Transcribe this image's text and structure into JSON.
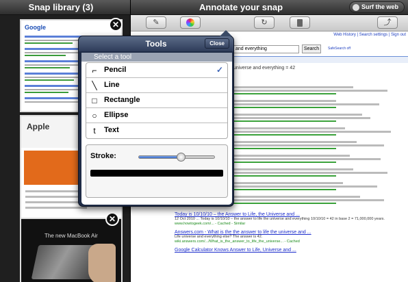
{
  "left_pane": {
    "title": "Snap library (3)",
    "thumbnails": [
      {
        "name": "google-search",
        "logo": "Google"
      },
      {
        "name": "apple-page",
        "logo": "Apple"
      },
      {
        "name": "macbook-air-video",
        "caption": "The new MacBook Air"
      }
    ]
  },
  "right_pane": {
    "title": "Annotate your snap",
    "surf_button": "Surf the web",
    "toolbar_icons": [
      "pencil-icon",
      "color-wheel-icon",
      "undo-icon",
      "trash-icon",
      "share-icon"
    ],
    "page": {
      "top_links": "Web History | Search settings | Sign out",
      "search_value": "and everything",
      "search_button": "Search",
      "advanced_link": "SafeSearch off",
      "result_line": "universe and everything = 42",
      "results": [
        {
          "title": "Today is 10/10/10 – the Answer to Life, the Universe and ...",
          "snippet": "12 Oct 2010 ... Today is 10/10/10 – the answer to life the universe and everything 10/10/10 = 42 in base 2 = 71,000,000 years.",
          "url": "www.howtogeek.com/... - Cached - Similar"
        },
        {
          "title": "Answers.com - What is the the answer to life the universe and ...",
          "snippet": "Life universe and everything else? The answer is 42.",
          "url": "wiki.answers.com/.../What_is_the_answer_to_life_the_universe... - Cached"
        },
        {
          "title": "Google Calculator Knows Answer to Life, Universe and ...",
          "snippet": "",
          "url": ""
        }
      ]
    }
  },
  "tools_popover": {
    "title": "Tools",
    "close_label": "Close",
    "section_header": "Select a tool",
    "tools": [
      {
        "label": "Pencil",
        "icon": "pencil-tool-icon",
        "glyph": "⌐",
        "selected": true
      },
      {
        "label": "Line",
        "icon": "line-tool-icon",
        "glyph": "╲",
        "selected": false
      },
      {
        "label": "Rectangle",
        "icon": "rectangle-tool-icon",
        "glyph": "□",
        "selected": false
      },
      {
        "label": "Ellipse",
        "icon": "ellipse-tool-icon",
        "glyph": "○",
        "selected": false
      },
      {
        "label": "Text",
        "icon": "text-tool-icon",
        "glyph": "t",
        "selected": false
      }
    ],
    "check_glyph": "✓",
    "stroke_label": "Stroke:",
    "stroke_level": 0.55
  },
  "close_glyph": "✕",
  "colors": {
    "accent": "#3f66b7",
    "popover": "#1f2c46"
  }
}
